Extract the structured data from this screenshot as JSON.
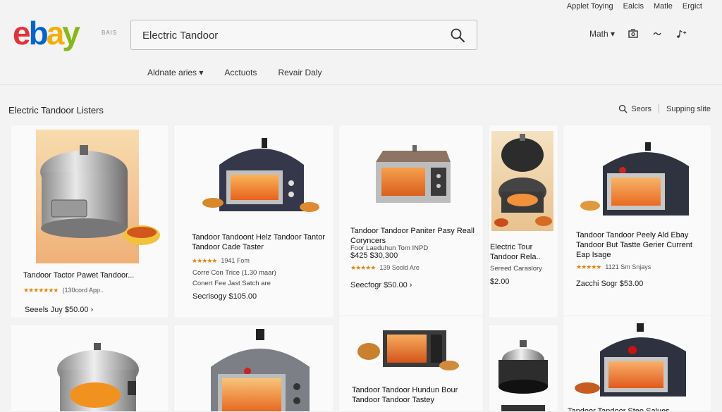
{
  "top_links": [
    "Applet Toying",
    "Ealcis",
    "Matle",
    "Ergict"
  ],
  "logo": {
    "e": "e",
    "b": "b",
    "a": "a",
    "y": "y",
    "sub": "BAIS"
  },
  "search": {
    "value": "Electric Tandoor"
  },
  "header_right": {
    "menu_label": "Math ▾"
  },
  "nav": [
    "Aldnate aries ▾",
    "Acctuots",
    "Revair Daly"
  ],
  "section": {
    "title": "Electric Tandoor Listers",
    "search_label": "Seors",
    "sort_label": "Supping slite"
  },
  "listings": [
    {
      "title": "Tandoor Tactor Pawet Tandoor...",
      "stars": "★★★★★★★",
      "rating": "(130cord App..",
      "price": "Seeels Juy $50.00 ›"
    },
    {
      "title": "Tandoor Tandoont Helz Tandoor Tantor Tandoor Cade Taster",
      "stars": "★★★★★",
      "rating": "1941 Fom",
      "meta1": "Corre Con Trice (1.30 maar)",
      "meta2": "Conert Fee Jast Satch are",
      "price": "Secrisogy $105.00"
    },
    {
      "title": "Tandoor Tandoor Paniter Pasy Reall Coryncers",
      "meta1": "Foor Laeduhun Tom INPD",
      "meta2": "$425 $30,300",
      "stars": "★★★★★",
      "rating": "139 Soold Are",
      "price": "Seecfogr $50.00 ›"
    },
    {
      "title": "Electric Tour Tandoor Rela..",
      "meta1": "Sereed Caraslory",
      "price": "$2.00"
    },
    {
      "title": "Tandoor Tandoor Peely Ald Ebay Tandoor But Tastte Gerier Current Eap Isage",
      "stars": "★★★★★",
      "rating": "1121 Sm Snjays",
      "price": "Zacchi Sogr $53.00"
    },
    {
      "title": "",
      "price": ""
    },
    {
      "title": "",
      "price": ""
    },
    {
      "title": "Tandoor Tandoor Hundun Bour Tandoor Tandoor Tastey",
      "stars": "★★★★★",
      "rating": "",
      "price": ""
    },
    {
      "title": "",
      "price": ""
    },
    {
      "title": "Tandoor Tandoor Steo Salues",
      "price": ""
    }
  ],
  "colors": {
    "logo_e": "#e53238",
    "logo_b": "#0064d2",
    "logo_a": "#f5af02",
    "logo_y": "#86b817",
    "star": "#e8830e",
    "oven_glow": "#f07a28"
  }
}
